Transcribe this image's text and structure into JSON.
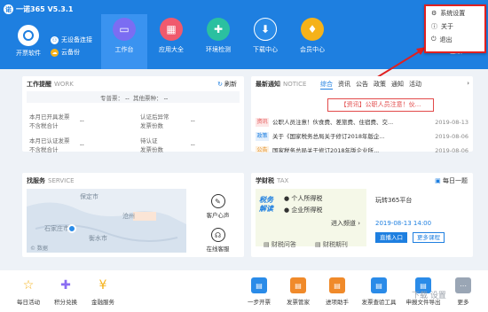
{
  "app": {
    "title": "一诺365 V5.3.1",
    "logo_glyph": "诺"
  },
  "topbar": {
    "open_software": "开票软件",
    "device_status": "无设备连接",
    "cloud_backup": "云备份",
    "nav": [
      {
        "label": "工作台",
        "icon": "workbench-icon",
        "glyph": "▭",
        "color": "#7b6df2"
      },
      {
        "label": "应用大全",
        "icon": "apps-icon",
        "glyph": "▦",
        "color": "#f05a6d"
      },
      {
        "label": "环境检测",
        "icon": "env-check-icon",
        "glyph": "✚",
        "color": "#2bc0a0"
      },
      {
        "label": "下载中心",
        "icon": "download-icon",
        "glyph": "⬇",
        "color": "#2a8be8"
      },
      {
        "label": "会员中心",
        "icon": "member-icon",
        "glyph": "♦",
        "color": "#f5b21a"
      }
    ],
    "login": "登录"
  },
  "menu": {
    "items": [
      {
        "label": "系统设置",
        "icon": "settings-icon",
        "glyph": "⚙"
      },
      {
        "label": "关于",
        "icon": "info-icon",
        "glyph": "ⓘ"
      },
      {
        "label": "退出",
        "icon": "exit-icon",
        "glyph": "⏻"
      }
    ]
  },
  "work": {
    "title": "工作提醒",
    "title_en": "WORK",
    "refresh": "刷新",
    "special_label": "专普票：",
    "special_val": "--",
    "other_label": "其他票种：",
    "other_val": "--",
    "issued_label": "本月已开具发票",
    "issued_sub": "不含税合计",
    "issued_val": "--",
    "backlog_label": "认证后异常",
    "backlog_sub": "发票份数",
    "backlog_val": "--",
    "certified_label": "本月已认证发票",
    "certified_sub": "不含税合计",
    "certified_val": "--",
    "pending_label": "待认证",
    "pending_sub": "发票份数",
    "pending_val": "--"
  },
  "notice": {
    "title": "最新通知",
    "title_en": "NOTICE",
    "tabs": [
      "综合",
      "资讯",
      "公告",
      "政策",
      "通知",
      "活动"
    ],
    "banner": "【资讯】公职人员注意！伙...",
    "rows": [
      {
        "tag": "资讯",
        "tag_color": "#e24a4a",
        "tag_bg": "#fde7e7",
        "text": "公职人员注意！伙食费、差旅费、住宿费、交...",
        "date": "2019-08-13"
      },
      {
        "tag": "政策",
        "tag_color": "#1e7fe0",
        "tag_bg": "#e3effc",
        "text": "关于《国家税务总局关于修订2018年版企...",
        "date": "2019-08-06"
      },
      {
        "tag": "公告",
        "tag_color": "#e08a1e",
        "tag_bg": "#fdf0de",
        "text": "国家税务总局关于修订2018年版企业所...",
        "date": "2019-08-06"
      }
    ]
  },
  "service": {
    "title": "找服务",
    "title_en": "SERVICE",
    "map_labels": [
      "保定市",
      "沧州",
      "石家庄市",
      "衡水市"
    ],
    "map_footer": "© 数据",
    "center": "客户心声",
    "online": "在线客服"
  },
  "tax": {
    "title": "学财税",
    "title_en": "TAX",
    "daily": "每日一题",
    "brand": "税务解读",
    "items": [
      "个人所得税",
      "企业所得税"
    ],
    "channel": "进入频道",
    "qa": "财税问答",
    "journal": "财税期刊",
    "platform": "玩转365平台",
    "date_time": "2019-08-13  14:00",
    "enter": "直播入口",
    "more": "更多课程"
  },
  "bottom": {
    "left": [
      {
        "label": "每日活动",
        "icon": "activity-icon",
        "glyph": "☆",
        "color": "#f5b21a"
      },
      {
        "label": "积分兑换",
        "icon": "gift-icon",
        "glyph": "✚",
        "color": "#8a6df2"
      },
      {
        "label": "金融服务",
        "icon": "finance-icon",
        "glyph": "¥",
        "color": "#f5b21a"
      }
    ],
    "right": [
      {
        "label": "一步开票",
        "icon": "quick-invoice-icon",
        "glyph": "▤",
        "color": "#2a8be8"
      },
      {
        "label": "发票管家",
        "icon": "invoice-manager-icon",
        "glyph": "▤",
        "color": "#f08a2a"
      },
      {
        "label": "进项助手",
        "icon": "input-helper-icon",
        "glyph": "▤",
        "color": "#f08a2a"
      },
      {
        "label": "发票查验工具",
        "icon": "invoice-check-icon",
        "glyph": "▤",
        "color": "#2a8be8"
      },
      {
        "label": "申报文件导出",
        "icon": "export-icon",
        "glyph": "▤",
        "color": "#2a8be8"
      },
      {
        "label": "更多",
        "icon": "more-icon",
        "glyph": "⋯",
        "color": "#9aa6b5"
      }
    ]
  },
  "watermark": "下载 设置"
}
